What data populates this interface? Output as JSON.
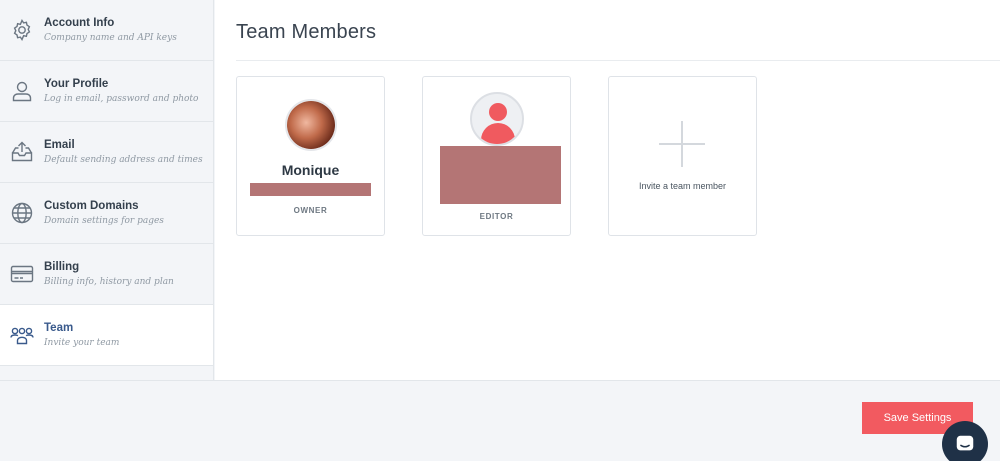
{
  "sidebar": {
    "items": [
      {
        "title": "Account Info",
        "subtitle": "Company name and API keys",
        "icon": "gear-icon"
      },
      {
        "title": "Your Profile",
        "subtitle": "Log in email, password and photo",
        "icon": "user-icon"
      },
      {
        "title": "Email",
        "subtitle": "Default sending address and times",
        "icon": "inbox-upload-icon"
      },
      {
        "title": "Custom Domains",
        "subtitle": "Domain settings for pages",
        "icon": "globe-icon"
      },
      {
        "title": "Billing",
        "subtitle": "Billing info, history and plan",
        "icon": "credit-card-icon"
      },
      {
        "title": "Team",
        "subtitle": "Invite your team",
        "icon": "team-icon",
        "active": true
      }
    ]
  },
  "main": {
    "title": "Team Members",
    "members": [
      {
        "name": "Monique",
        "role": "OWNER",
        "avatar": "photo"
      },
      {
        "name": "",
        "role": "EDITOR",
        "avatar": "default-avatar-icon"
      }
    ],
    "invite_label": "Invite a team member"
  },
  "footer": {
    "save_label": "Save Settings"
  },
  "colors": {
    "accent": "#f25a60",
    "active_nav": "#3a5a8c",
    "chat": "#1f3147",
    "redaction": "#b47575"
  }
}
